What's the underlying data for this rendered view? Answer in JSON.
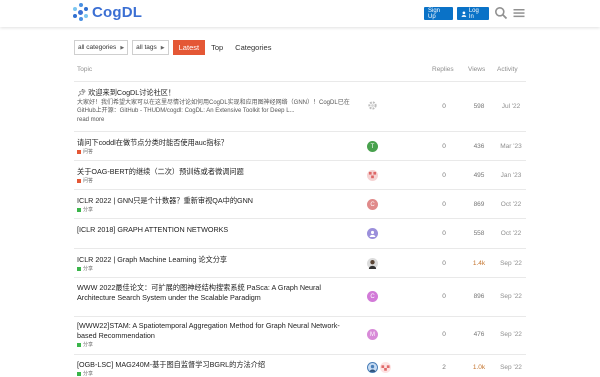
{
  "header": {
    "logo_text": "CogDL",
    "signup_label": "Sign Up",
    "login_label": "Log In",
    "icons": [
      "person-icon",
      "search-icon",
      "hamburger-menu-icon"
    ]
  },
  "nav": {
    "categories_dropdown": "all categories",
    "tags_dropdown": "all tags",
    "tabs": [
      {
        "label": "Latest"
      },
      {
        "label": "Top"
      },
      {
        "label": "Categories"
      }
    ]
  },
  "table": {
    "headers": {
      "topic": "Topic",
      "replies": "Replies",
      "views": "Views",
      "activity": "Activity"
    },
    "rows": [
      {
        "title": "欢迎来到CogDL讨论社区！",
        "pinned": true,
        "excerpt": "大家好！我们希望大家可以在这里尽情讨论如何用CogDL实现和应用图神经网络（GNN）！CogDL已在GitHub上开源：GitHub - THUDM/cogdl: CogDL: An Extensive Toolkit for Deep L...",
        "read_more": "read more",
        "category": "",
        "avatar_letter": "",
        "avatar_color": "#bbbbbb",
        "replies": "0",
        "views": "598",
        "activity": "Jul '22"
      },
      {
        "title": "请问下coddl在做节点分类时能否使用auc指标？",
        "category": "问答",
        "category_color": "#e45735",
        "avatar_letter": "T",
        "avatar_color": "#48a14d",
        "replies": "0",
        "views": "436",
        "activity": "Mar '23"
      },
      {
        "title": "关于OAG-BERT的继续（二次）预训练或者微调问题",
        "category": "问答",
        "category_color": "#e45735",
        "avatar_letter": "",
        "avatar_color": "#f0c4c4",
        "replies": "0",
        "views": "495",
        "activity": "Jan '23"
      },
      {
        "title": "ICLR 2022 | GNN只是个计数器？重新审视QA中的GNN",
        "category": "分享",
        "category_color": "#3ab54a",
        "avatar_letter": "C",
        "avatar_color": "#e08a8a",
        "replies": "0",
        "views": "869",
        "activity": "Oct '22"
      },
      {
        "title": "[ICLR 2018] GRAPH ATTENTION NETWORKS",
        "category": "",
        "avatar_letter": "",
        "avatar_color": "#9b8fdb",
        "replies": "0",
        "views": "558",
        "activity": "Oct '22"
      },
      {
        "title": "ICLR 2022 | Graph Machine Learning 论文分享",
        "category": "分享",
        "category_color": "#3ab54a",
        "avatar_letter": "",
        "avatar_color": "#444444",
        "replies": "0",
        "views": "1.4k",
        "views_hot": true,
        "activity": "Sep '22"
      },
      {
        "title": "WWW 2022最佳论文：可扩展的图神经结构搜索系统 PaSca: A Graph Neural Architecture Search System under the Scalable Paradigm",
        "category": "分享",
        "category_color": "#3ab54a",
        "avatar_letter": "C",
        "avatar_color": "#d27ad8",
        "replies": "0",
        "views": "896",
        "activity": "Sep '22"
      },
      {
        "title": "[WWW22]STAM: A Spatiotemporal Aggregation Method for Graph Neural Network-based Recommendation",
        "category": "分享",
        "category_color": "#3ab54a",
        "avatar_letter": "M",
        "avatar_color": "#d88ad8",
        "replies": "0",
        "views": "476",
        "activity": "Sep '22"
      },
      {
        "title": "[OGB-LSC] MAG240M-基于图自监督学习BGRL的方法介绍",
        "category": "分享",
        "category_color": "#3ab54a",
        "avatar_letter": "",
        "avatar_color": "#4a7fb8",
        "replies": "2",
        "views": "1.0k",
        "views_hot": true,
        "activity": "Sep '22"
      }
    ]
  }
}
